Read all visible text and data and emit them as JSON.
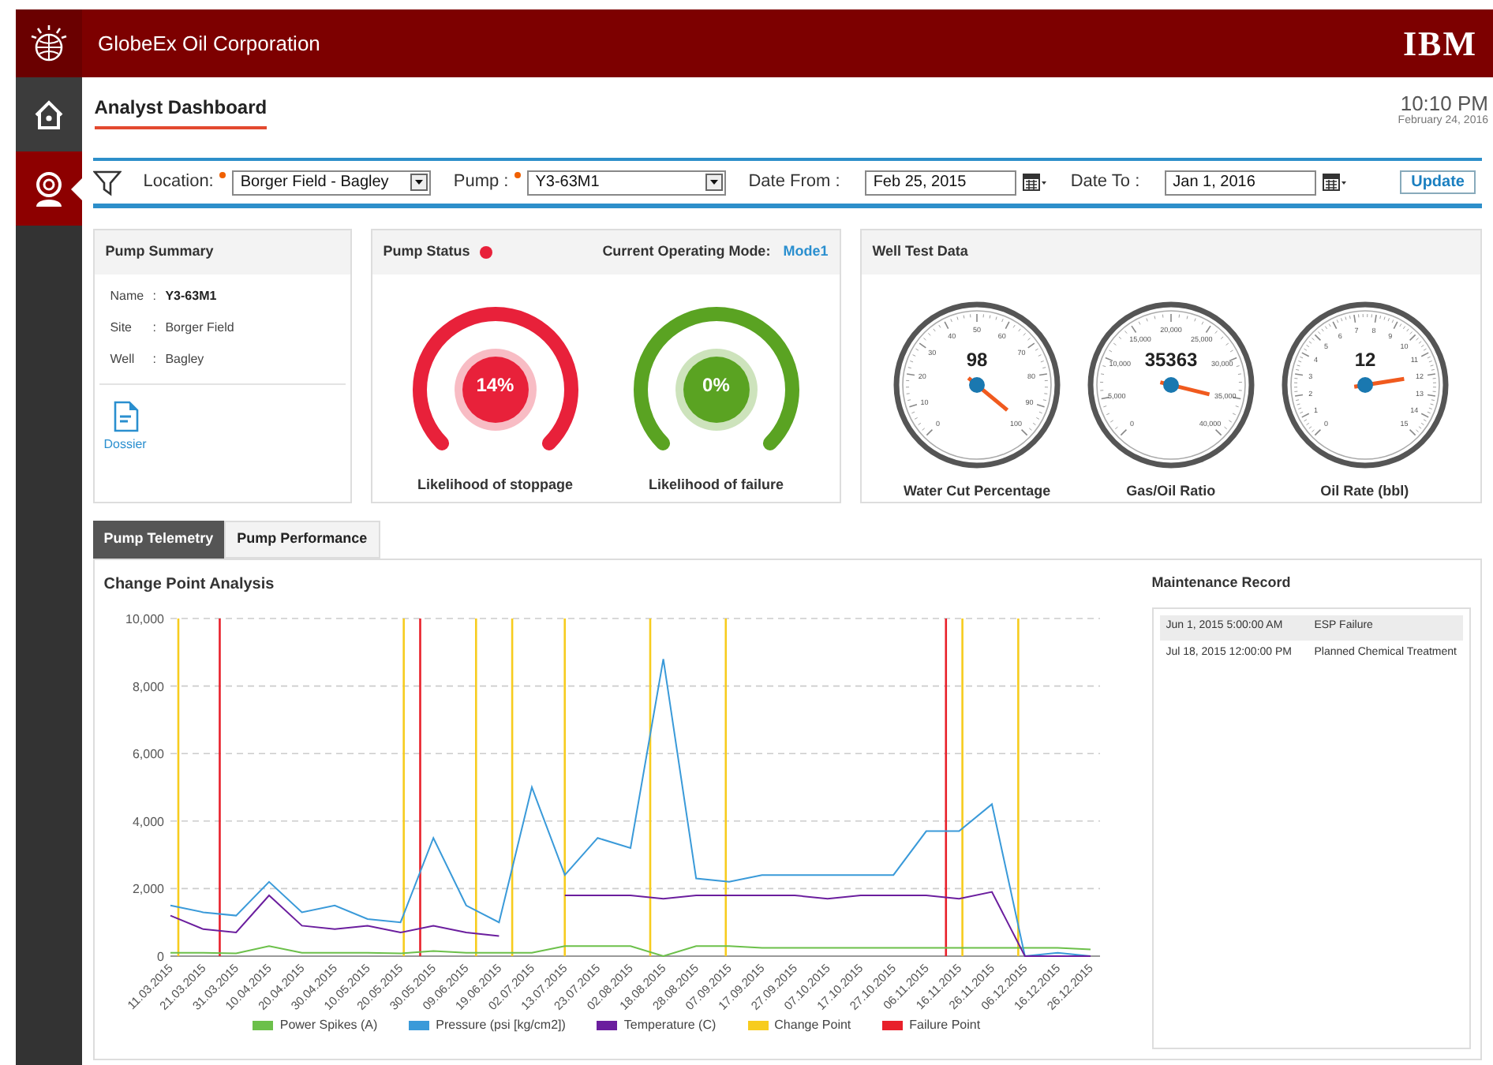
{
  "header": {
    "company": "GlobeEx Oil Corporation",
    "brand": "IBM"
  },
  "sidebar": {
    "items": [
      {
        "selected": false
      },
      {
        "selected": true
      }
    ]
  },
  "page": {
    "title": "Analyst Dashboard",
    "time": "10:10 PM",
    "date": "February 24, 2016"
  },
  "filters": {
    "location": {
      "label": "Location:",
      "value": "Borger Field - Bagley",
      "required": true
    },
    "pump": {
      "label": "Pump :",
      "value": "Y3-63M1",
      "required": true
    },
    "date_from": {
      "label": "Date From :",
      "value": "Feb 25, 2015"
    },
    "date_to": {
      "label": "Date To :",
      "value": "Jan 1, 2016"
    },
    "button": "Update"
  },
  "pump_summary": {
    "title": "Pump Summary",
    "fields": [
      {
        "label": "Name",
        "separator": ":",
        "value": "Y3-63M1"
      },
      {
        "label": "Site",
        "separator": ":",
        "value": "Borger Field"
      },
      {
        "label": "Well",
        "separator": ":",
        "value": "Bagley"
      }
    ],
    "dossier": "Dossier"
  },
  "pump_status": {
    "title": "Pump Status",
    "status_dot": {
      "color": "#e8213a"
    },
    "mode_label": "Current Operating Mode:",
    "mode": "Mode1",
    "gauges": [
      {
        "value": "14%",
        "label": "Likelihood of stoppage",
        "color": "#e8213a"
      },
      {
        "value": "0%",
        "label": "Likelihood of failure",
        "color": "#5aa322"
      }
    ]
  },
  "well_test": {
    "title": "Well Test Data",
    "dials": [
      {
        "reading": "98",
        "label": "Water Cut Percentage",
        "scale": [
          "0",
          "10",
          "20",
          "30",
          "40",
          "50",
          "60",
          "70",
          "80",
          "90",
          "100"
        ]
      },
      {
        "reading": "35363",
        "label": "Gas/Oil Ratio",
        "scale": [
          "0",
          "5,000",
          "10,000",
          "15,000",
          "20,000",
          "25,000",
          "30,000",
          "35,000",
          "40,000"
        ]
      },
      {
        "reading": "12",
        "label": "Oil Rate (bbl)",
        "scale": [
          "0",
          "1",
          "2",
          "3",
          "4",
          "5",
          "6",
          "7",
          "8",
          "9",
          "10",
          "11",
          "12",
          "13",
          "14",
          "15"
        ]
      }
    ]
  },
  "tabs": [
    {
      "label": "Pump Telemetry",
      "selected": true
    },
    {
      "label": "Pump Performance",
      "selected": false
    }
  ],
  "chart": {
    "chart_data": {
      "type": "line",
      "title": "Change Point Analysis",
      "categories": [
        "11.03.2015",
        "21.03.2015",
        "31.03.2015",
        "10.04.2015",
        "20.04.2015",
        "30.04.2015",
        "10.05.2015",
        "20.05.2015",
        "30.05.2015",
        "09.06.2015",
        "19.06.2015",
        "02.07.2015",
        "13.07.2015",
        "23.07.2015",
        "02.08.2015",
        "18.08.2015",
        "28.08.2015",
        "07.09.2015",
        "17.09.2015",
        "27.09.2015",
        "07.10.2015",
        "17.10.2015",
        "27.10.2015",
        "06.11.2015",
        "16.11.2015",
        "26.11.2015",
        "06.12.2015",
        "16.12.2015",
        "26.12.2015"
      ],
      "ylim": [
        0,
        10000
      ],
      "yticks": [
        {
          "value": 0,
          "label": "0"
        },
        {
          "value": 2000,
          "label": "2,000"
        },
        {
          "value": 4000,
          "label": "4,000"
        },
        {
          "value": 6000,
          "label": "6,000"
        },
        {
          "value": 8000,
          "label": "8,000"
        },
        {
          "value": 10000,
          "label": "10,000"
        }
      ],
      "series": [
        {
          "name": "Power Spikes (A)",
          "color": "#6cc04a",
          "values": [
            100,
            100,
            80,
            300,
            100,
            100,
            100,
            80,
            150,
            100,
            100,
            100,
            300,
            300,
            300,
            0,
            300,
            300,
            250,
            250,
            250,
            250,
            250,
            250,
            250,
            250,
            250,
            250,
            200
          ]
        },
        {
          "name": "Pressure (psi [kg/cm2])",
          "color": "#3a9ad9",
          "values": [
            1500,
            1300,
            1200,
            2200,
            1300,
            1500,
            1100,
            1000,
            3500,
            1500,
            1000,
            5000,
            2400,
            3500,
            3200,
            8800,
            2300,
            2200,
            2400,
            2400,
            2400,
            2400,
            2400,
            3700,
            3700,
            4500,
            0,
            100,
            0
          ]
        },
        {
          "name": "Temperature (C)",
          "color": "#6b1e9e",
          "values": [
            1200,
            800,
            700,
            1800,
            900,
            800,
            900,
            700,
            900,
            700,
            600,
            null,
            1800,
            1800,
            1800,
            1700,
            1800,
            1800,
            1800,
            1800,
            1700,
            1800,
            1800,
            1800,
            1700,
            1900,
            0,
            0,
            0
          ]
        }
      ],
      "grid": true,
      "legend": "bottom"
    },
    "markers": [
      {
        "name": "Change Point",
        "color": "#f7cc1e"
      },
      {
        "name": "Failure Point",
        "color": "#e8202a"
      }
    ]
  },
  "maintenance": {
    "title": "Maintenance Record",
    "rows": [
      {
        "time": "Jun 1, 2015 5:00:00 AM",
        "event": "ESP Failure",
        "selected": true
      },
      {
        "time": "Jul 18, 2015 12:00:00 PM",
        "event": "Planned Chemical Treatment",
        "selected": false
      }
    ]
  }
}
